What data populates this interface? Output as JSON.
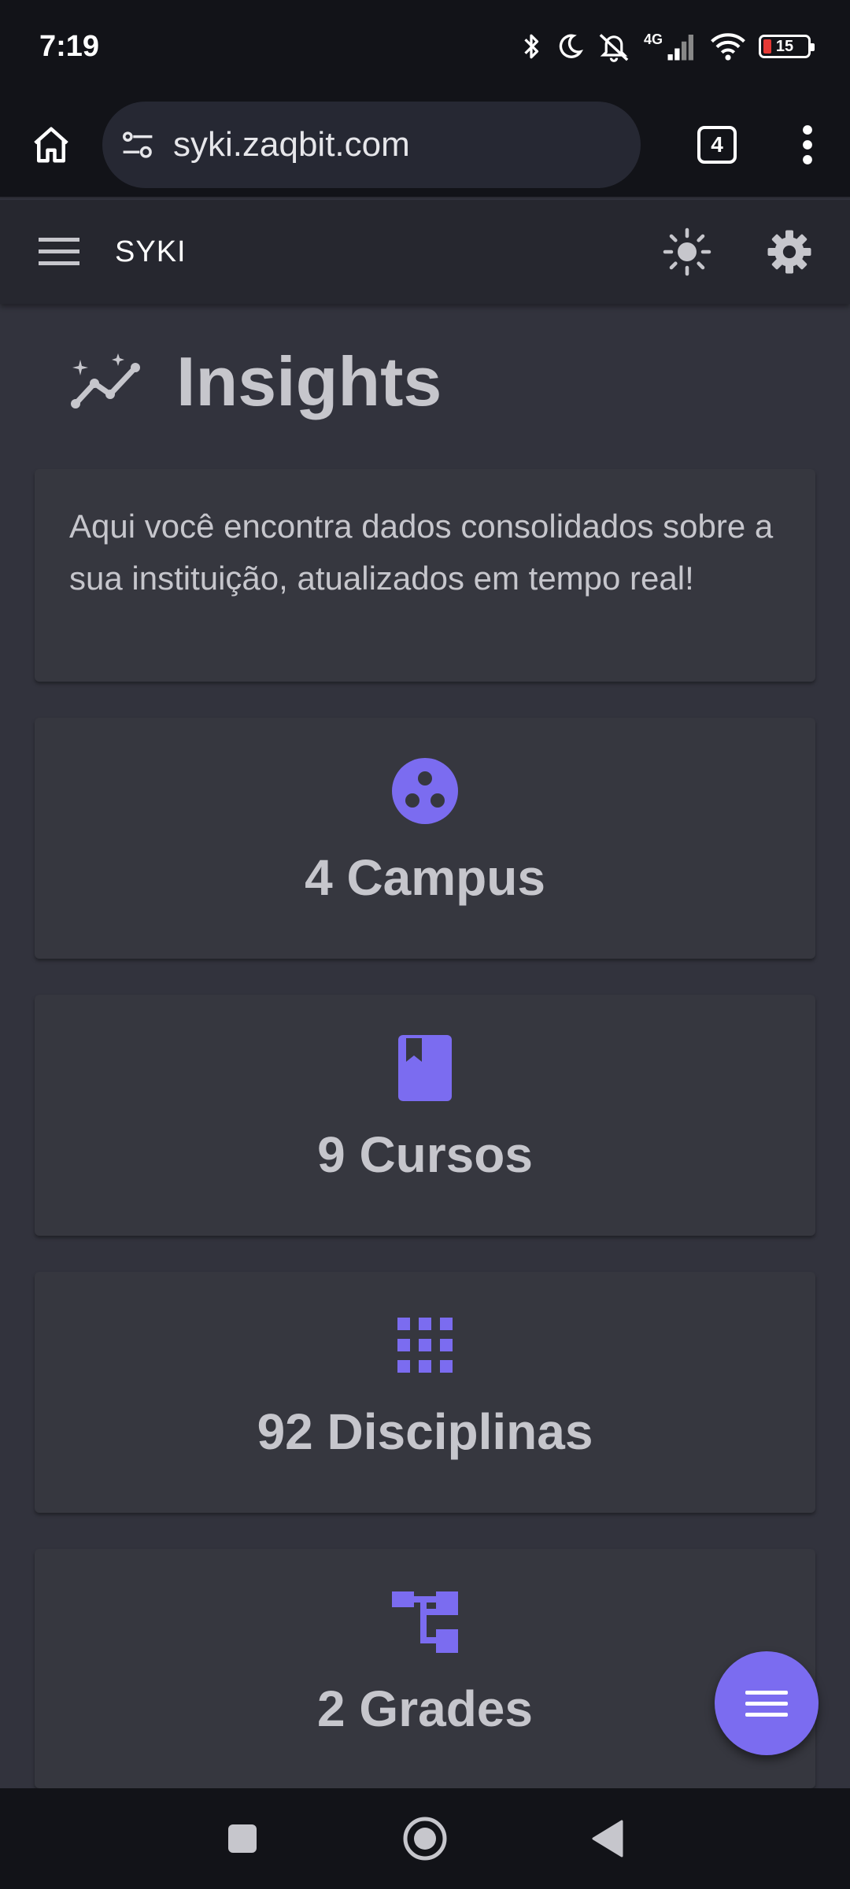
{
  "status_bar": {
    "time": "7:19",
    "network": "4G",
    "battery": "15"
  },
  "browser": {
    "url": "syki.zaqbit.com",
    "tab_count": "4"
  },
  "app_bar": {
    "title": "SYKI"
  },
  "page": {
    "title": "Insights",
    "description": "Aqui você encontra dados consolidados sobre a sua instituição, atualizados em tempo real!"
  },
  "stats": [
    {
      "label": "4 Campus",
      "icon": "campus-icon"
    },
    {
      "label": "9 Cursos",
      "icon": "book-icon"
    },
    {
      "label": "92 Disciplinas",
      "icon": "grid-icon"
    },
    {
      "label": "2 Grades",
      "icon": "hierarchy-icon"
    }
  ],
  "colors": {
    "accent": "#7b6cf0",
    "background": "#32333d",
    "card": "#36373f",
    "app_bar": "#26272f",
    "text": "#c6c6cc"
  }
}
